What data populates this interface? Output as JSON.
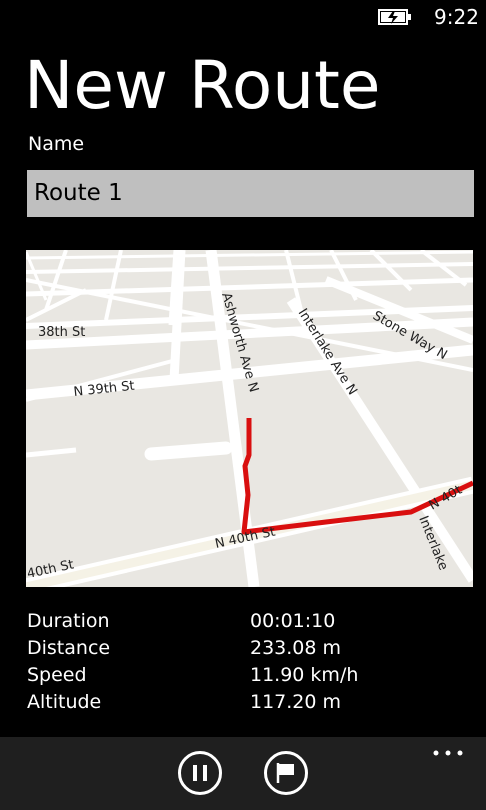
{
  "status": {
    "time": "9:22",
    "battery_icon": "battery-charging-icon"
  },
  "page": {
    "title": "New Route"
  },
  "form": {
    "name_label": "Name",
    "name_value": "Route 1"
  },
  "map": {
    "streets": {
      "st38": "38th St",
      "n39": "N 39th St",
      "n40": "N 40th St",
      "st40_left": "40th St",
      "ashworth": "Ashworth Ave N",
      "interlake": "Interlake Ave N",
      "stone_way": "Stone Way N",
      "n40_right": "N 40t",
      "interlake_lower": "Interlake"
    },
    "route_color": "#d90f0f"
  },
  "stats": [
    {
      "label": "Duration",
      "value": "00:01:10"
    },
    {
      "label": "Distance",
      "value": "233.08 m"
    },
    {
      "label": "Speed",
      "value": "11.90 km/h"
    },
    {
      "label": "Altitude",
      "value": "117.20 m"
    }
  ],
  "app_bar": {
    "pause_icon": "pause-icon",
    "flag_icon": "flag-icon",
    "more_icon": "more-options-icon"
  }
}
